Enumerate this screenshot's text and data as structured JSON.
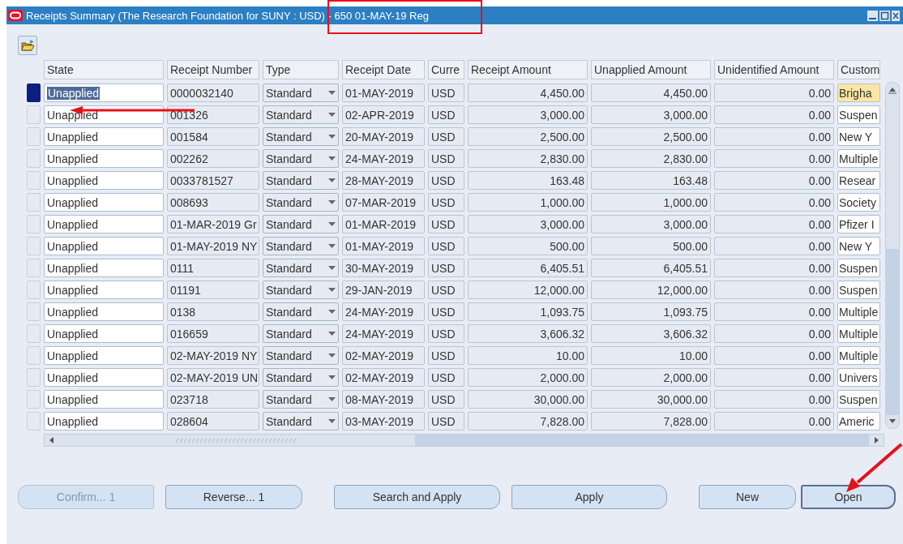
{
  "window": {
    "title": "Receipts Summary (The Research Foundation for SUNY : USD) - 650 01-MAY-19 Reg"
  },
  "table": {
    "columns": [
      "State",
      "Receipt Number",
      "Type",
      "Receipt Date",
      "Curre",
      "Receipt Amount",
      "Unapplied Amount",
      "Unidentified Amount",
      "Custom"
    ],
    "rows": [
      {
        "selected": true,
        "cells": [
          "Unapplied",
          "0000032140",
          "Standard",
          "01-MAY-2019",
          "USD",
          "4,450.00",
          "4,450.00",
          "0.00",
          "Brigha"
        ]
      },
      {
        "selected": false,
        "cells": [
          "Unapplied",
          "001326",
          "Standard",
          "02-APR-2019",
          "USD",
          "3,000.00",
          "3,000.00",
          "0.00",
          "Suspen"
        ]
      },
      {
        "selected": false,
        "cells": [
          "Unapplied",
          "001584",
          "Standard",
          "20-MAY-2019",
          "USD",
          "2,500.00",
          "2,500.00",
          "0.00",
          "New Y"
        ]
      },
      {
        "selected": false,
        "cells": [
          "Unapplied",
          "002262",
          "Standard",
          "24-MAY-2019",
          "USD",
          "2,830.00",
          "2,830.00",
          "0.00",
          "Multiple"
        ]
      },
      {
        "selected": false,
        "cells": [
          "Unapplied",
          "0033781527",
          "Standard",
          "28-MAY-2019",
          "USD",
          "163.48",
          "163.48",
          "0.00",
          "Resear"
        ]
      },
      {
        "selected": false,
        "cells": [
          "Unapplied",
          "008693",
          "Standard",
          "07-MAR-2019",
          "USD",
          "1,000.00",
          "1,000.00",
          "0.00",
          "Society"
        ]
      },
      {
        "selected": false,
        "cells": [
          "Unapplied",
          "01-MAR-2019 Gr",
          "Standard",
          "01-MAR-2019",
          "USD",
          "3,000.00",
          "3,000.00",
          "0.00",
          "Pfizer I"
        ]
      },
      {
        "selected": false,
        "cells": [
          "Unapplied",
          "01-MAY-2019 NY",
          "Standard",
          "01-MAY-2019",
          "USD",
          "500.00",
          "500.00",
          "0.00",
          "New Y"
        ]
      },
      {
        "selected": false,
        "cells": [
          "Unapplied",
          "0111",
          "Standard",
          "30-MAY-2019",
          "USD",
          "6,405.51",
          "6,405.51",
          "0.00",
          "Suspen"
        ]
      },
      {
        "selected": false,
        "cells": [
          "Unapplied",
          "01191",
          "Standard",
          "29-JAN-2019",
          "USD",
          "12,000.00",
          "12,000.00",
          "0.00",
          "Suspen"
        ]
      },
      {
        "selected": false,
        "cells": [
          "Unapplied",
          "0138",
          "Standard",
          "24-MAY-2019",
          "USD",
          "1,093.75",
          "1,093.75",
          "0.00",
          "Multiple"
        ]
      },
      {
        "selected": false,
        "cells": [
          "Unapplied",
          "016659",
          "Standard",
          "24-MAY-2019",
          "USD",
          "3,606.32",
          "3,606.32",
          "0.00",
          "Multiple"
        ]
      },
      {
        "selected": false,
        "cells": [
          "Unapplied",
          "02-MAY-2019 NY",
          "Standard",
          "02-MAY-2019",
          "USD",
          "10.00",
          "10.00",
          "0.00",
          "Multiple"
        ]
      },
      {
        "selected": false,
        "cells": [
          "Unapplied",
          "02-MAY-2019 UN",
          "Standard",
          "02-MAY-2019",
          "USD",
          "2,000.00",
          "2,000.00",
          "0.00",
          "Univers"
        ]
      },
      {
        "selected": false,
        "cells": [
          "Unapplied",
          "023718",
          "Standard",
          "08-MAY-2019",
          "USD",
          "30,000.00",
          "30,000.00",
          "0.00",
          "Suspen"
        ]
      },
      {
        "selected": false,
        "cells": [
          "Unapplied",
          "028604",
          "Standard",
          "03-MAY-2019",
          "USD",
          "7,828.00",
          "7,828.00",
          "0.00",
          "Americ"
        ]
      }
    ]
  },
  "buttons": [
    {
      "label": "Confirm... 1",
      "disabled": true,
      "focused": false
    },
    {
      "label": "Reverse... 1",
      "disabled": false,
      "focused": false
    },
    {
      "label": "Search and Apply",
      "disabled": false,
      "focused": false
    },
    {
      "label": "Apply",
      "disabled": false,
      "focused": false
    },
    {
      "label": "New",
      "disabled": false,
      "focused": false
    },
    {
      "label": "Open",
      "disabled": false,
      "focused": true
    }
  ]
}
